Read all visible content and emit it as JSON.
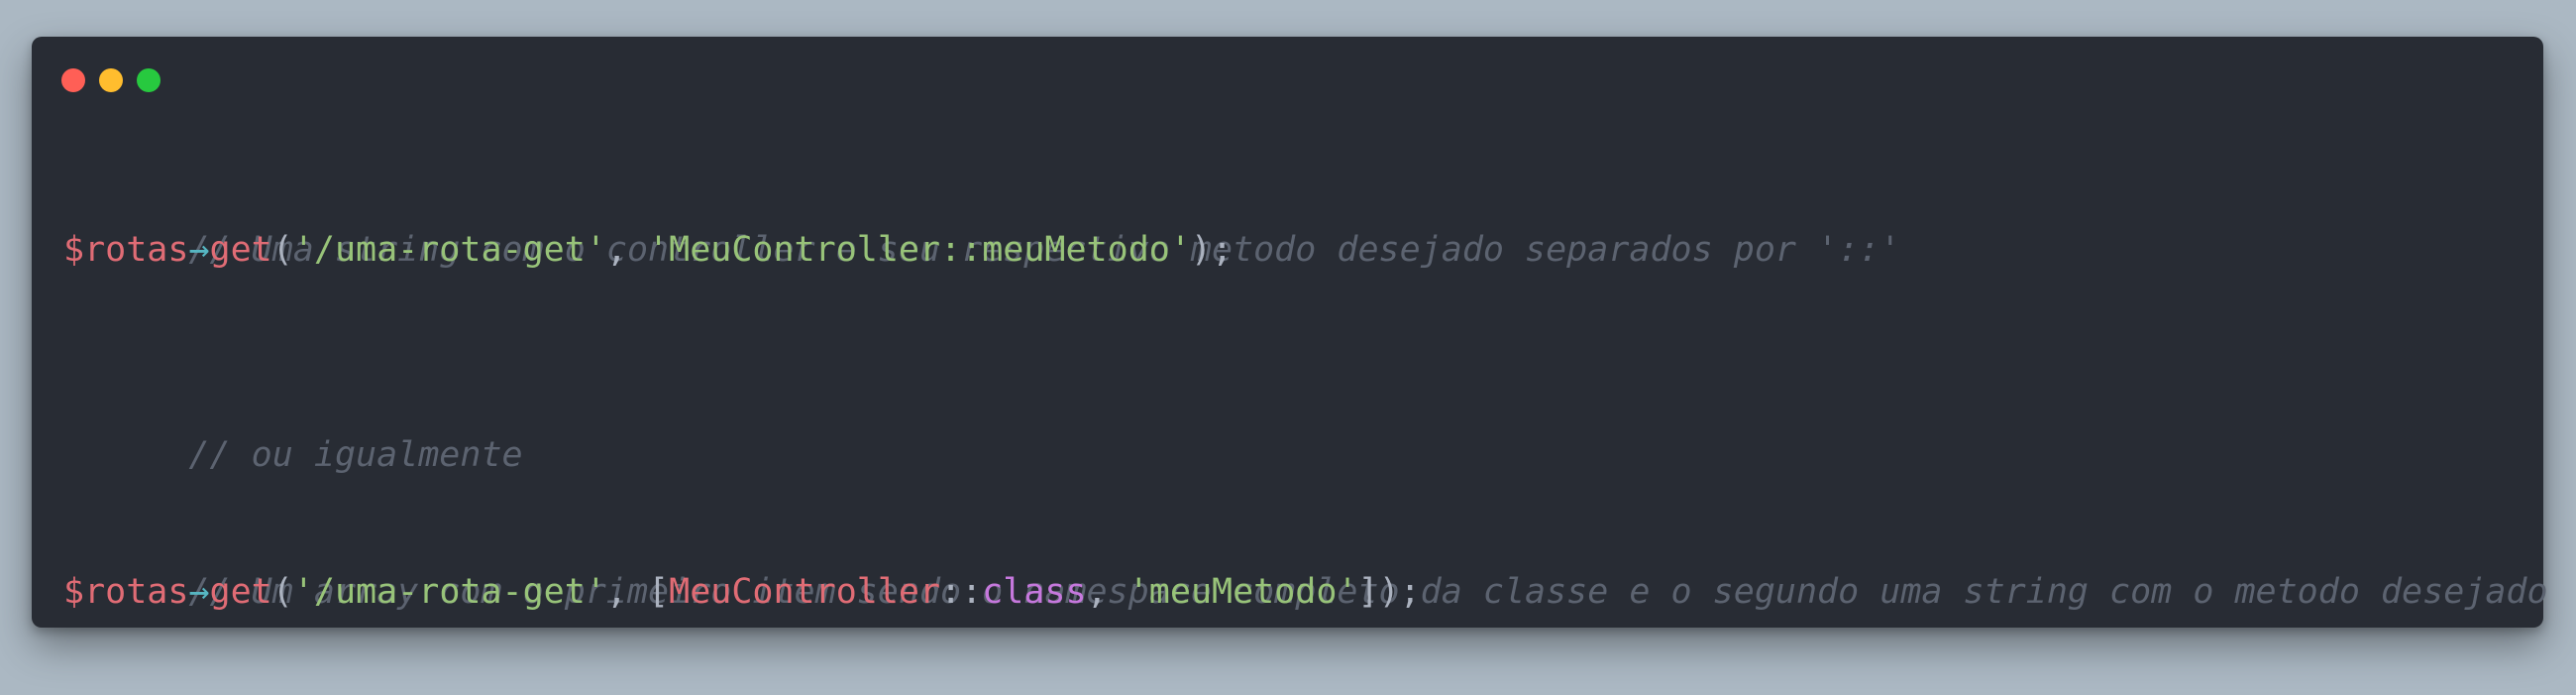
{
  "window": {
    "controls": [
      {
        "name": "close",
        "color": "#ff5f56"
      },
      {
        "name": "minimize",
        "color": "#ffbd2e"
      },
      {
        "name": "maximize",
        "color": "#27c93f"
      }
    ]
  },
  "code": {
    "line1": {
      "comment": "// Uma string com o controller e seu respectivo metodo desejado separados por '::'"
    },
    "line2": {
      "var": "$rotas",
      "arrow": "→",
      "method": "get",
      "open": "(",
      "route": "'/uma-rota-get'",
      "comma": ", ",
      "handler": "'MeuController::meuMetodo'",
      "close": ");"
    },
    "line4": {
      "comment": "// ou igualmente"
    },
    "line6": {
      "comment": "// Um array com o primeiro item sendo o namespace completo da classe e o segundo uma string com o metodo desejado"
    },
    "line7": {
      "var": "$rotas",
      "arrow": "→",
      "method": "get",
      "open": "(",
      "route": "'/uma-rota-get'",
      "comma": ", ",
      "bracket_open": "[",
      "class_name": "MeuController",
      "scope": "::",
      "class_kw": "class",
      "comma2": ", ",
      "method_str": "'meuMetodo'",
      "close": "]);"
    }
  }
}
